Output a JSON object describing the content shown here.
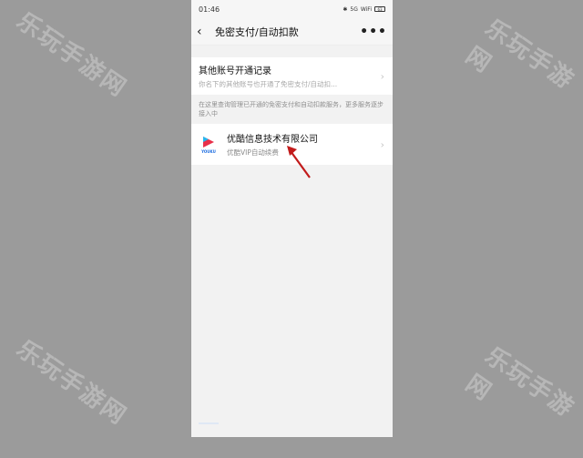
{
  "status": {
    "time": "01:46",
    "bluetooth": "✱",
    "signal_text": "5G",
    "wifi": "WiFi",
    "battery": "63"
  },
  "header": {
    "title": "免密支付/自动扣款",
    "more_label": "•••"
  },
  "records": {
    "title": "其他账号开通记录",
    "subtitle": "你名下的其他账号也开通了免密支付/自动扣..."
  },
  "note": "在这里查询管理已开通的免密支付和自动扣款服务，更多服务逐步接入中",
  "merchant": {
    "name": "优酷信息技术有限公司",
    "service": "优酷VIP自动续费",
    "logo_text": "YOUKU"
  },
  "watermark": "乐玩手游网",
  "colors": {
    "arrow": "#c21b1b",
    "accent": "#1a6be0"
  }
}
